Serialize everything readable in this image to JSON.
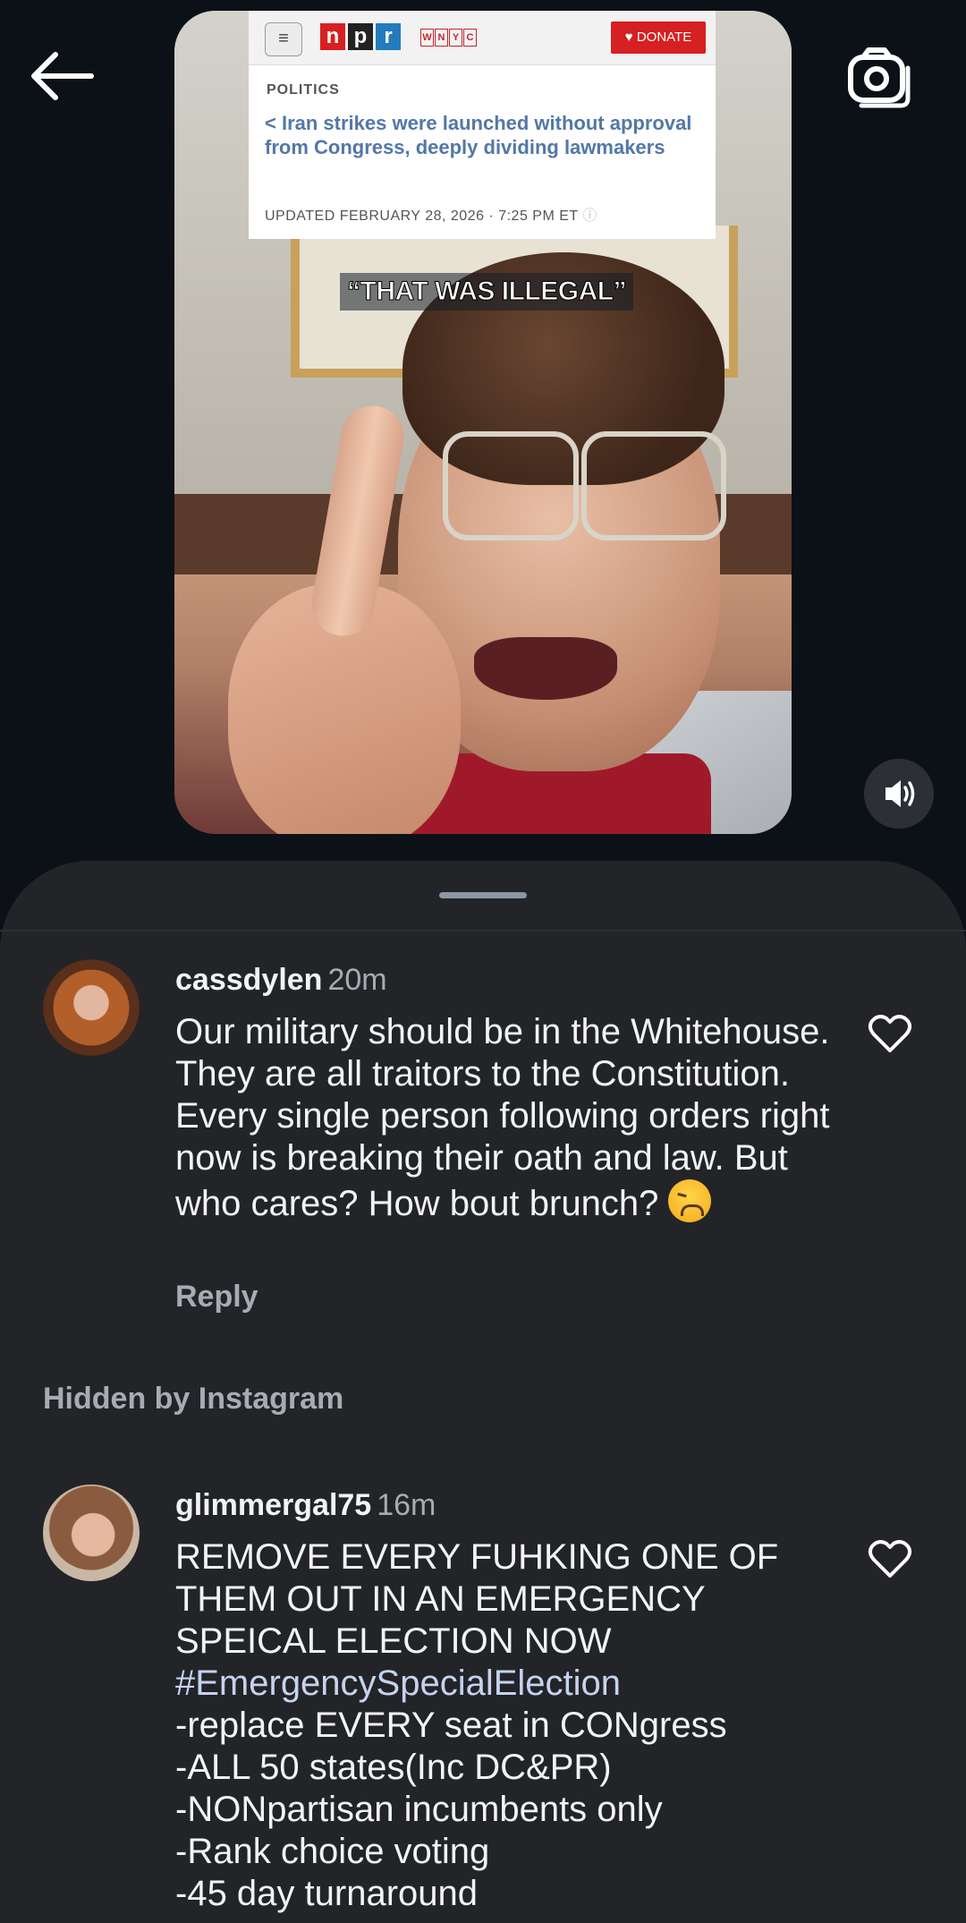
{
  "header": {
    "back_icon": "arrow-left-icon",
    "camera_icon": "camera-icon"
  },
  "video": {
    "npr": {
      "logo_letters": [
        "n",
        "p",
        "r"
      ],
      "station_letters": [
        "W",
        "N",
        "Y",
        "C"
      ],
      "donate_label": "DONATE",
      "category": "POLITICS",
      "headline": "< Iran strikes were launched without approval from Congress, deeply dividing lawmakers",
      "updated": "UPDATED FEBRUARY 28, 2026 · 7:25 PM ET"
    },
    "caption": "“THAT WAS ILLEGAL”",
    "sound_icon": "speaker-on-icon"
  },
  "comments": [
    {
      "username": "cassdylen",
      "time": "20m",
      "text": "Our military should be in the Whitehouse. They are all traitors to the Constitution. Every single person following orders right now is breaking their oath and law. But who cares? How bout brunch?",
      "emoji": "weary-face-icon",
      "reply_label": "Reply"
    },
    {
      "username": "glimmergal75",
      "time": "16m",
      "text_line1": "REMOVE EVERY FUHKING ONE OF THEM OUT IN AN EMERGENCY SPEICAL ELECTION NOW",
      "hashtag": "#EmergencySpecialElection",
      "lines": [
        "-replace EVERY seat in CONgress",
        "-ALL 50 states(Inc DC&PR)",
        "-NONpartisan incumbents only",
        "-Rank choice voting",
        "-45 day turnaround"
      ]
    }
  ],
  "hidden_note": "Hidden by Instagram",
  "colors": {
    "background": "#0c1118",
    "sheet": "#232428",
    "hashtag": "#c5d3ef",
    "donate": "#d62021"
  }
}
